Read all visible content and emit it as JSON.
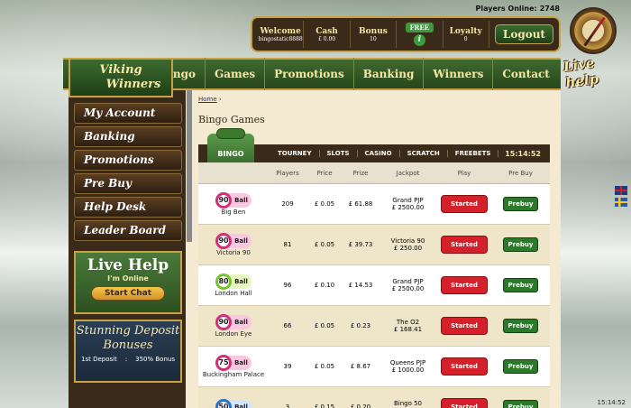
{
  "players_online": {
    "label": "Players Online:",
    "value": "2748"
  },
  "account": {
    "welcome": {
      "label": "Welcome",
      "value": "bingostatic8888"
    },
    "cash": {
      "label": "Cash",
      "value": "£ 0.00"
    },
    "bonus": {
      "label": "Bonus",
      "value": "10"
    },
    "free_label": "FREE",
    "info_icon": "i",
    "loyalty": {
      "label": "Loyalty",
      "value": "0"
    },
    "logout": "Logout"
  },
  "live_help_badge": "Live help",
  "logo": {
    "line1": "Viking",
    "line2": "Winners"
  },
  "nav": [
    "Bingo",
    "Games",
    "Promotions",
    "Banking",
    "Winners",
    "Contact Us"
  ],
  "sidebar": [
    "My Account",
    "Banking",
    "Promotions",
    "Pre Buy",
    "Help Desk",
    "Leader Board"
  ],
  "live_help": {
    "title": "Live Help",
    "status": "I'm Online",
    "button": "Start Chat"
  },
  "deposit_bonuses": {
    "title": "Stunning Deposit Bonuses",
    "row_label": "1st Deposit",
    "row_sep": ":",
    "row_value": "350% Bonus"
  },
  "breadcrumb": "Home",
  "page_title": "Bingo Games",
  "bingo_tab": "BINGO",
  "tabs": [
    "TOURNEY",
    "SLOTS",
    "CASINO",
    "SCRATCH",
    "FREEBETS"
  ],
  "clock": "15:14:52",
  "bottom_clock": "15:14:52",
  "columns": [
    "Players",
    "Price",
    "Prize",
    "Jackpot",
    "Play",
    "Pre Buy"
  ],
  "rows": [
    {
      "ball": "90",
      "ball_label": "Ball",
      "color": "#d0307a",
      "name": "Big Ben",
      "players": "209",
      "price": "£ 0.05",
      "prize": "£ 61.88",
      "jackpot_name": "Grand PJP",
      "jackpot": "£ 2500.00",
      "play": "Started",
      "prebuy": "Prebuy"
    },
    {
      "ball": "90",
      "ball_label": "Ball",
      "color": "#d0307a",
      "name": "Victoria 90",
      "players": "81",
      "price": "£ 0.05",
      "prize": "£ 39.73",
      "jackpot_name": "Victoria 90",
      "jackpot": "£ 250.00",
      "play": "Started",
      "prebuy": "Prebuy"
    },
    {
      "ball": "80",
      "ball_label": "Ball",
      "color": "#7ac030",
      "name": "London Hall",
      "players": "96",
      "price": "£ 0.10",
      "prize": "£ 14.53",
      "jackpot_name": "Grand PJP",
      "jackpot": "£ 2500.00",
      "play": "Started",
      "prebuy": "Prebuy"
    },
    {
      "ball": "90",
      "ball_label": "Ball",
      "color": "#d0307a",
      "name": "London Eye",
      "players": "66",
      "price": "£ 0.05",
      "prize": "£ 0.23",
      "jackpot_name": "The O2",
      "jackpot": "£ 168.41",
      "play": "Started",
      "prebuy": "Prebuy"
    },
    {
      "ball": "75",
      "ball_label": "Ball",
      "color": "#d0307a",
      "name": "Buckingham Palace",
      "players": "39",
      "price": "£ 0.05",
      "prize": "£ 8.67",
      "jackpot_name": "Queens PJP",
      "jackpot": "£ 1000.00",
      "play": "Started",
      "prebuy": "Prebuy"
    },
    {
      "ball": "50",
      "ball_label": "Ball",
      "color": "#2a70d0",
      "name": "",
      "players": "3",
      "price": "£ 0.15",
      "prize": "£ 0.20",
      "jackpot_name": "Bingo 50",
      "jackpot": "£ 264.45",
      "play": "Started",
      "prebuy": "Prebuy"
    }
  ]
}
